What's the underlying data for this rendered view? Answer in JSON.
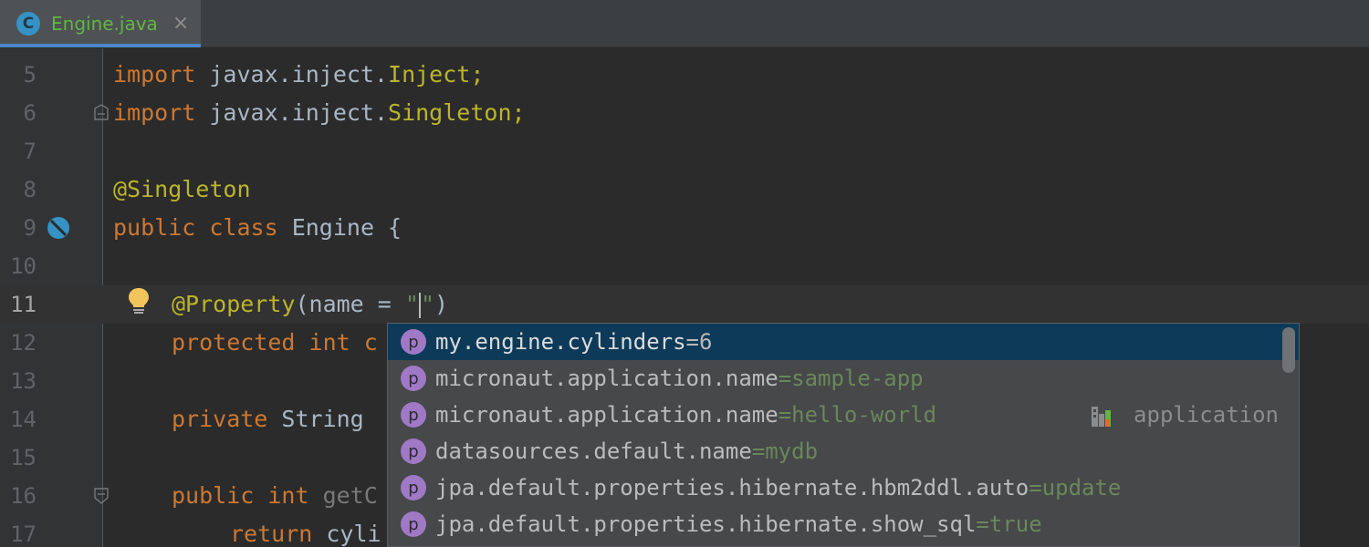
{
  "tab": {
    "icon_letter": "C",
    "title": "Engine.java",
    "close_glyph": "×"
  },
  "lines": [
    {
      "num": "5",
      "t1": "import",
      "t2": " javax.inject.",
      "t3": "Inject;"
    },
    {
      "num": "6",
      "t1": "import",
      "t2": " javax.inject.",
      "t3": "Singleton;"
    },
    {
      "num": "7"
    },
    {
      "num": "8",
      "t1": "@Singleton"
    },
    {
      "num": "9",
      "t1": "public",
      "t2": " ",
      "t3": "class",
      "t4": " Engine {"
    },
    {
      "num": "10"
    },
    {
      "num": "11",
      "t1": "@Property",
      "t2": "(",
      "t3": "name",
      "t4": " = ",
      "t5": "\"",
      "t6": "\"",
      "t7": ")"
    },
    {
      "num": "12",
      "t1": "protected",
      "t2": " ",
      "t3": "int",
      "t4": " c"
    },
    {
      "num": "13"
    },
    {
      "num": "14",
      "t1": "private",
      "t2": " String "
    },
    {
      "num": "15"
    },
    {
      "num": "16",
      "t1": "public",
      "t2": " ",
      "t3": "int",
      "t4": " ",
      "t5": "getC"
    },
    {
      "num": "17",
      "t1": "return",
      "t2": " cyli"
    }
  ],
  "completion": {
    "items": [
      {
        "key": "my.engine.cylinders",
        "value": "=6"
      },
      {
        "key": "micronaut.application.name",
        "value": "=sample-app"
      },
      {
        "key": "micronaut.application.name",
        "value": "=hello-world",
        "type": "application"
      },
      {
        "key": "datasources.default.name",
        "value": "=mydb"
      },
      {
        "key": "jpa.default.properties.hibernate.hbm2ddl.auto",
        "value": "=update"
      },
      {
        "key": "jpa.default.properties.hibernate.show_sql",
        "value": "=true"
      }
    ],
    "icon_letter": "p"
  },
  "colors": {
    "keyword": "#cc7832",
    "annotation": "#bbb529",
    "string": "#6a8759",
    "selection": "#0d3a58",
    "tab_title": "#62b543",
    "tab_underline": "#4a88c7"
  },
  "icons": [
    "class-icon",
    "close-icon",
    "fold-icon",
    "bean-icon",
    "bulb-icon",
    "property-icon",
    "bar-chart-icon"
  ]
}
